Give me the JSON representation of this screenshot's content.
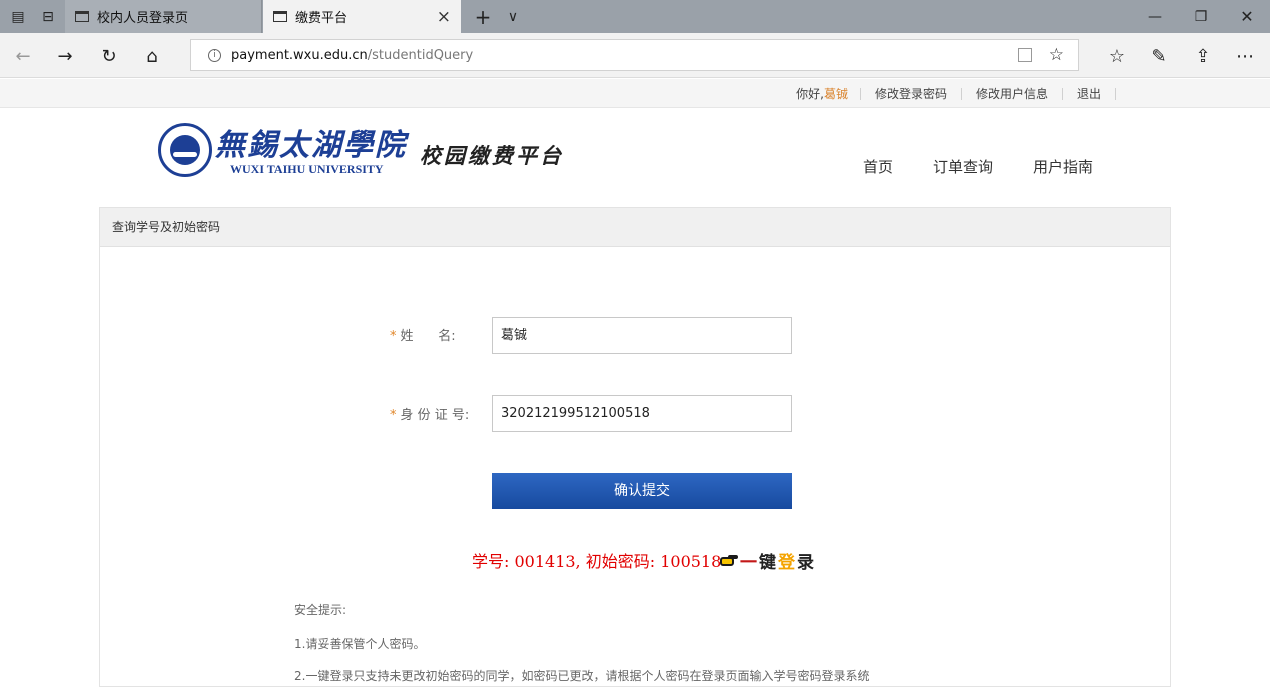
{
  "browser": {
    "tabs": [
      {
        "label": "校内人员登录页",
        "active": false
      },
      {
        "label": "缴费平台",
        "active": true
      }
    ],
    "new_tab_symbol": "+",
    "tab_list_symbol": "∨",
    "url_host": "payment.wxu.edu.cn",
    "url_path": "/studentidQuery"
  },
  "userbar": {
    "greeting": "你好,",
    "username": "葛铖",
    "links": [
      "修改登录密码",
      "修改用户信息",
      "退出"
    ]
  },
  "header": {
    "logo_cn": "無錫太湖學院",
    "logo_en": "WUXI TAIHU UNIVERSITY",
    "platform_title": "校园缴费平台",
    "nav": [
      "首页",
      "订单查询",
      "用户指南"
    ]
  },
  "panel": {
    "title": "查询学号及初始密码",
    "required_mark": "*",
    "name_label": "姓      名:",
    "name_value": "葛铖",
    "id_label": "身 份 证 号:",
    "id_value": "320212199512100518",
    "submit_label": "确认提交",
    "result_text": "学号: 001413, 初始密码: 100518",
    "onekey_chars": [
      "一",
      "键",
      "登",
      "录"
    ],
    "tips_title": "安全提示:",
    "tip_1": "1.请妥善保管个人密码。",
    "tip_2": "2.一键登录只支持未更改初始密码的同学，如密码已更改，请根据个人密码在登录页面输入学号密码登录系统"
  },
  "colors": {
    "brand_blue": "#1d3f95",
    "button_blue": "#174a9f",
    "required": "#e0862a",
    "result_red": "#e10000"
  }
}
